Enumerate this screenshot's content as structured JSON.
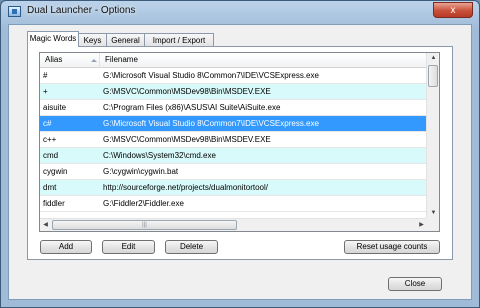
{
  "window": {
    "title": "Dual Launcher - Options",
    "close_glyph": "x"
  },
  "tabs": [
    {
      "label": "Magic Words",
      "active": true
    },
    {
      "label": "Keys",
      "active": false
    },
    {
      "label": "General",
      "active": false
    },
    {
      "label": "Import / Export",
      "active": false
    }
  ],
  "list": {
    "columns": [
      "Alias",
      "Filename"
    ],
    "rows": [
      {
        "alias": "#",
        "filename": "G:\\Microsoft Visual Studio 8\\Common7\\IDE\\VCSExpress.exe"
      },
      {
        "alias": "+",
        "filename": "G:\\MSVC\\Common\\MSDev98\\Bin\\MSDEV.EXE"
      },
      {
        "alias": "aisuite",
        "filename": "C:\\Program Files (x86)\\ASUS\\AI Suite\\AiSuite.exe"
      },
      {
        "alias": "c#",
        "filename": "G:\\Microsoft Visual Studio 8\\Common7\\IDE\\VCSExpress.exe"
      },
      {
        "alias": "c++",
        "filename": "G:\\MSVC\\Common\\MSDev98\\Bin\\MSDEV.EXE"
      },
      {
        "alias": "cmd",
        "filename": "C:\\Windows\\System32\\cmd.exe"
      },
      {
        "alias": "cygwin",
        "filename": "G:\\cygwin\\cygwin.bat"
      },
      {
        "alias": "dmt",
        "filename": "http://sourceforge.net/projects/dualmonitortool/"
      },
      {
        "alias": "fiddler",
        "filename": "G:\\Fiddler2\\Fiddler.exe"
      }
    ],
    "selected_index": 3,
    "thumb_grip": "|||"
  },
  "buttons": {
    "add": "Add",
    "edit": "Edit",
    "delete": "Delete",
    "reset": "Reset usage counts",
    "close": "Close"
  },
  "colors": {
    "selection": "#3399ff",
    "alt_row": "#d9fafa"
  }
}
